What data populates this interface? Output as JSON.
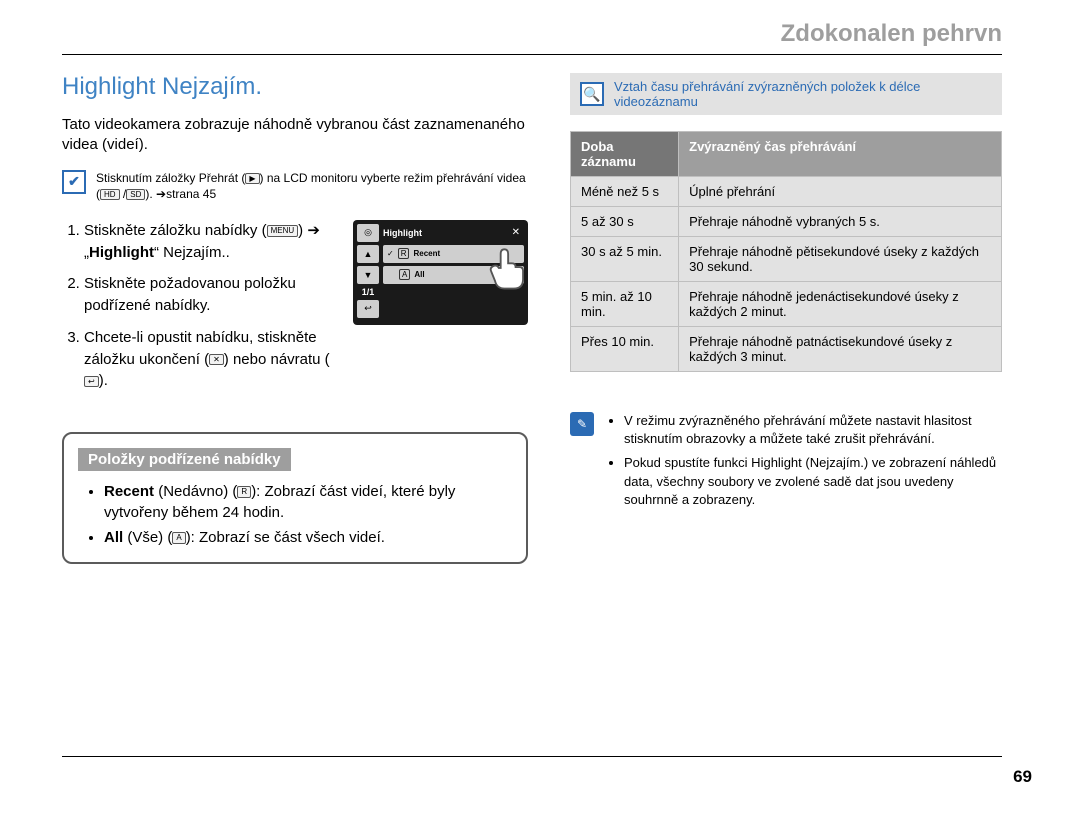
{
  "header_title": "Zdokonalen pehrvn",
  "section_title": "Highlight Nejzajím.",
  "intro_text": "Tato videokamera zobrazuje náhodně vybranou část zaznamenaného videa (videí).",
  "play_note": {
    "prefix": "Stisknutím záložky Přehrát (",
    "after_icon1": ") na LCD monitoru vyberte režim přehrávání videa (",
    "hd": "HD",
    "sd": "SD",
    "suffix": "). ➔strana 45"
  },
  "steps": {
    "s1_a": "Stiskněte záložku nabídky (",
    "s1_b": ") ➔ „",
    "s1_bold": "Highlight",
    "s1_c": "“ Nejzajím..",
    "s2": "Stiskněte požadovanou položku podřízené nabídky.",
    "s3_a": "Chcete-li opustit nabídku, stiskněte záložku ukončení (",
    "s3_b": ") nebo návratu (",
    "s3_c": ")."
  },
  "icons": {
    "menu": "MENU",
    "play": "▶",
    "close": "✕",
    "return": "↩"
  },
  "lcd": {
    "title": "Highlight",
    "row1": "Recent",
    "row2": "All",
    "page": "1/1",
    "check": "✓",
    "r": "R",
    "a": "A"
  },
  "submenu_box": {
    "title": "Položky podřízené nabídky",
    "items": [
      {
        "bold": "Recent",
        "paren": " (Nedávno) (",
        "icon": "R",
        "after": "): Zobrazí část videí, které byly vytvořeny během 24 hodin."
      },
      {
        "bold": "All",
        "paren": " (Vše) (",
        "icon": "A",
        "after": "): Zobrazí se část všech videí."
      }
    ]
  },
  "relation_text": "Vztah času přehrávání zvýrazněných položek k délce videozáznamu",
  "table": {
    "head_left": "Doba záznamu",
    "head_right": "Zvýrazněný čas přehrávání",
    "rows": [
      {
        "a": "Méně než 5 s",
        "b": "Úplné přehrání"
      },
      {
        "a": "5 až 30 s",
        "b": "Přehraje náhodně vybraných 5 s."
      },
      {
        "a": "30 s až 5 min.",
        "b": "Přehraje náhodně pětisekundové úseky z každých 30 sekund."
      },
      {
        "a": "5 min. až 10 min.",
        "b": "Přehraje náhodně jedenáctisekundové úseky z každých 2 minut."
      },
      {
        "a": "Přes 10 min.",
        "b": "Přehraje náhodně patnáctisekundové úseky z každých 3 minut."
      }
    ]
  },
  "notes": {
    "n1": "V režimu zvýrazněného přehrávání můžete nastavit hlasitost stisknutím obrazovky a můžete také zrušit přehrávání.",
    "n2": "Pokud spustíte funkci Highlight (Nejzajím.) ve zobrazení náhledů data, všechny soubory ve zvolené sadě dat jsou uvedeny souhrnně a zobrazeny."
  },
  "page_number": "69",
  "search_glyph": "🔍",
  "pencil_glyph": "✎"
}
